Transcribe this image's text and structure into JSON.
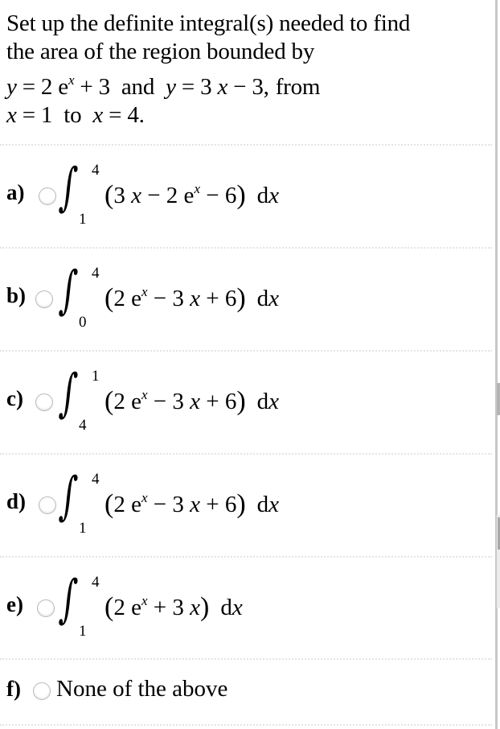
{
  "question": {
    "line1": "Set up the definite integral(s) needed to find",
    "line2": "the area of the region bounded by",
    "eq1": {
      "y": "y",
      "eq": " = 2 e",
      "exp": "x",
      "rest": " + 3"
    },
    "and_word": "and",
    "eq2": {
      "y": "y",
      "eq": " = 3 ",
      "x": "x",
      "rest": " − 3,",
      "from": "from"
    },
    "range": {
      "x1": "x",
      "eq1": " = 1",
      "to": "to",
      "x2": "x",
      "eq2": " = 4."
    }
  },
  "options": [
    {
      "letter": "a)",
      "upper": "4",
      "lower": "1",
      "parts": {
        "open": "(",
        "p1": "3 ",
        "v1": "x",
        "p2": " − 2 e",
        "exp": "x",
        "p3": " − 6",
        "close": ")",
        "dx_d": "d",
        "dx_x": "x"
      },
      "selected": false
    },
    {
      "letter": "b)",
      "upper": "4",
      "lower": "0",
      "parts": {
        "open": "(",
        "p1": "2 e",
        "exp": "x",
        "p2": " − 3 ",
        "v1": "x",
        "p3": " + 6",
        "close": ")",
        "dx_d": "d",
        "dx_x": "x"
      },
      "selected": false
    },
    {
      "letter": "c)",
      "upper": "1",
      "lower": "4",
      "parts": {
        "open": "(",
        "p1": "2 e",
        "exp": "x",
        "p2": " − 3 ",
        "v1": "x",
        "p3": " + 6",
        "close": ")",
        "dx_d": "d",
        "dx_x": "x"
      },
      "selected": false
    },
    {
      "letter": "d)",
      "upper": "4",
      "lower": "1",
      "parts": {
        "open": "(",
        "p1": "2 e",
        "exp": "x",
        "p2": " − 3 ",
        "v1": "x",
        "p3": " + 6",
        "close": ")",
        "dx_d": "d",
        "dx_x": "x"
      },
      "selected": false
    },
    {
      "letter": "e)",
      "upper": "4",
      "lower": "1",
      "parts": {
        "open": "(",
        "p1": "2 e",
        "exp": "x",
        "p2": " + 3 ",
        "v1": "x",
        "p3": "",
        "close": ")",
        "dx_d": "d",
        "dx_x": "x"
      },
      "selected": false
    },
    {
      "letter": "f)",
      "text": "None of the above",
      "selected": false
    }
  ]
}
